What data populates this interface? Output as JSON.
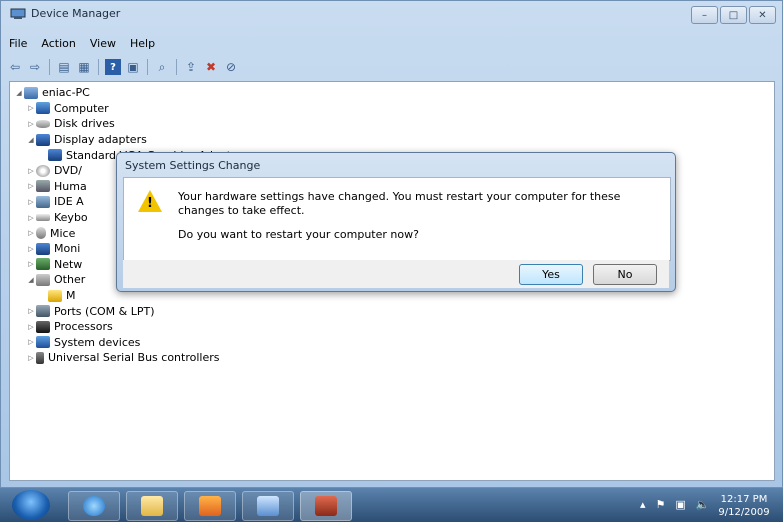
{
  "window": {
    "title": "Device Manager",
    "controls": [
      "minimize",
      "maximize",
      "close"
    ]
  },
  "menu": [
    "File",
    "Action",
    "View",
    "Help"
  ],
  "toolbar": [
    "back-icon",
    "forward-icon",
    "properties-icon",
    "show-hide-icon",
    "help-icon",
    "console-icon",
    "scan-icon",
    "update-driver-icon",
    "disable-icon",
    "uninstall-icon"
  ],
  "tree": {
    "root": "eniac-PC",
    "items": [
      {
        "label": "Computer",
        "expanded": false
      },
      {
        "label": "Disk drives",
        "expanded": false
      },
      {
        "label": "Display adapters",
        "expanded": true
      },
      {
        "label": "Standard VGA Graphics Adapter",
        "child": true
      },
      {
        "label": "DVD/",
        "expanded": false
      },
      {
        "label": "Huma",
        "expanded": false
      },
      {
        "label": "IDE A",
        "expanded": false
      },
      {
        "label": "Keybo",
        "expanded": false
      },
      {
        "label": "Mice",
        "expanded": false
      },
      {
        "label": "Moni",
        "expanded": false
      },
      {
        "label": "Netw",
        "expanded": false
      },
      {
        "label": "Other",
        "expanded": true
      },
      {
        "label": "M",
        "child": true
      },
      {
        "label": "Ports (COM & LPT)",
        "expanded": false
      },
      {
        "label": "Processors",
        "expanded": false
      },
      {
        "label": "System devices",
        "expanded": false
      },
      {
        "label": "Universal Serial Bus controllers",
        "expanded": false
      }
    ]
  },
  "dialog": {
    "title": "System Settings Change",
    "message": "Your hardware settings have changed. You must restart your computer for these changes to take effect.",
    "question": "Do you want to restart your computer now?",
    "yes_label": "Yes",
    "no_label": "No"
  },
  "taskbar": {
    "apps": [
      "start-orb",
      "internet-explorer",
      "windows-explorer",
      "media-player",
      "control-panel",
      "device-manager"
    ],
    "time": "12:17 PM",
    "date": "9/12/2009"
  }
}
